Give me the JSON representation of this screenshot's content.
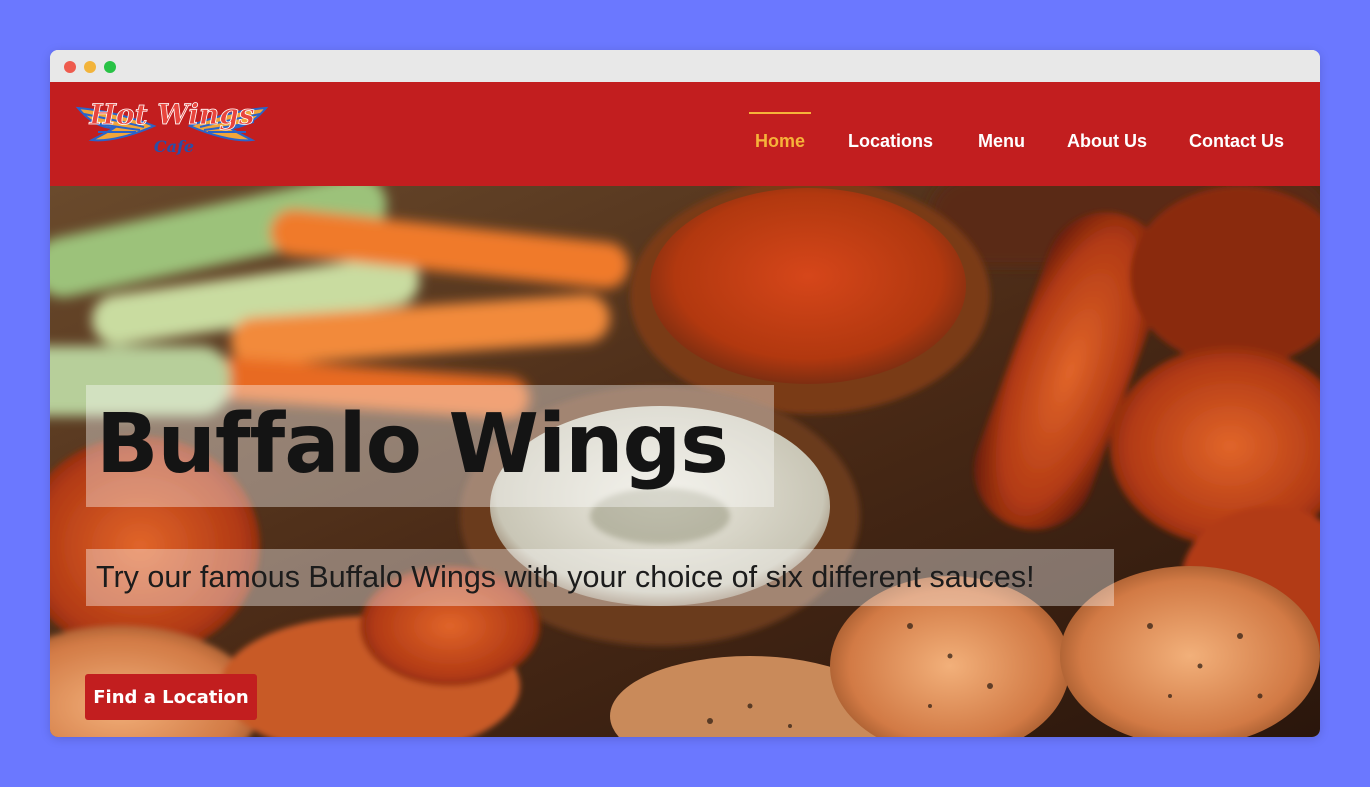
{
  "window": {
    "controls": [
      "close",
      "minimize",
      "maximize"
    ]
  },
  "header": {
    "logo": {
      "line1": "Hot Wings",
      "line2": "Cafe",
      "icon": "wings-logo-icon"
    },
    "nav": [
      {
        "label": "Home",
        "active": true
      },
      {
        "label": "Locations",
        "active": false
      },
      {
        "label": "Menu",
        "active": false
      },
      {
        "label": "About Us",
        "active": false
      },
      {
        "label": "Contact Us",
        "active": false
      }
    ]
  },
  "hero": {
    "title": "Buffalo Wings",
    "subtitle": "Try our famous Buffalo Wings with your choice of six different sauces!",
    "cta_label": "Find a Location",
    "image": "buffalo-wings-photo"
  },
  "colors": {
    "brand_red": "#c21e1f",
    "nav_active": "#f6b33a",
    "page_bg": "#6b78ff"
  }
}
